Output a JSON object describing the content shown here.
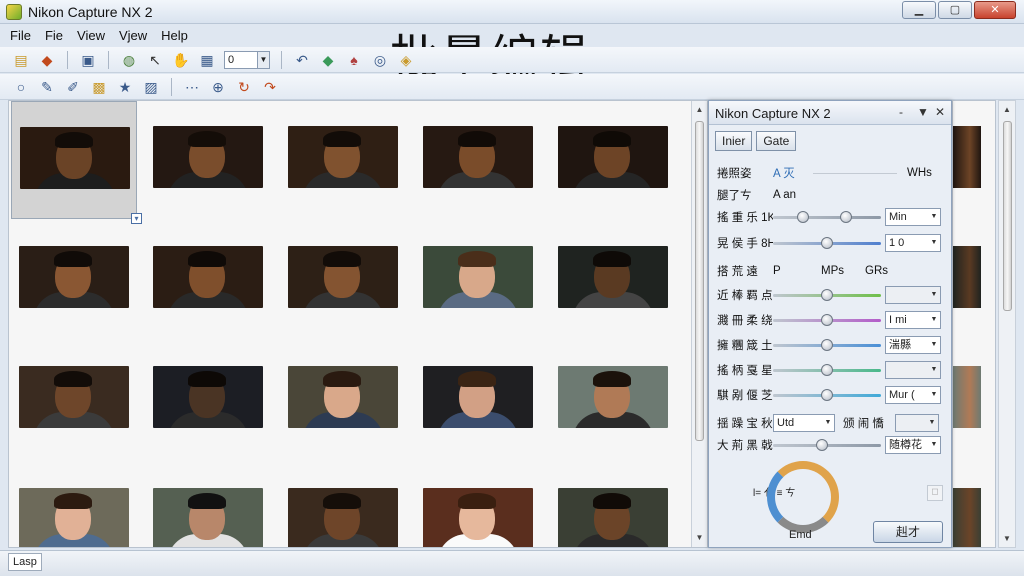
{
  "window": {
    "title": "Nikon Capture NX 2",
    "minimize": "▁",
    "maximize": "▢",
    "close": "✕"
  },
  "banner": "批量编辑",
  "menu": [
    "File",
    "Fie",
    "View",
    "Vjew",
    "Help"
  ],
  "toolbar": {
    "zoom_value": "0",
    "icons": [
      "new-file-icon",
      "open-icon",
      "save-icon",
      "zoom-icon",
      "pointer-icon",
      "hand-icon",
      "grid-icon"
    ]
  },
  "toolbar2_icons": [
    "search-icon",
    "lasso-icon",
    "brush-icon",
    "crop-icon",
    "star-icon",
    "edit-icon",
    "dots-icon",
    "zoom-in-icon",
    "rotate-icon",
    "undo-icon"
  ],
  "thumbnails": [
    {
      "skin": "#6a4326",
      "bg": "#2a1a10",
      "shirt": "#1d1d1d",
      "hair": "#120c08"
    },
    {
      "skin": "#7a4d2c",
      "bg": "#241812",
      "shirt": "#222",
      "hair": "#140d08"
    },
    {
      "skin": "#80522f",
      "bg": "#2f1f14",
      "shirt": "#2a2a2a",
      "hair": "#120c08"
    },
    {
      "skin": "#7a4c2a",
      "bg": "#261912",
      "shirt": "#333",
      "hair": "#110b07"
    },
    {
      "skin": "#6d4426",
      "bg": "#1f1510",
      "shirt": "#252525",
      "hair": "#0f0a06"
    },
    {
      "skin": "#8a5733",
      "bg": "#2a1e16",
      "shirt": "#2c2c2c",
      "hair": "#100b08"
    },
    {
      "skin": "#7f4f2c",
      "bg": "#2b1d14",
      "shirt": "#292929",
      "hair": "#0f0a07"
    },
    {
      "skin": "#845431",
      "bg": "#2d2016",
      "shirt": "#333",
      "hair": "#120c08"
    },
    {
      "skin": "#d8a88a",
      "bg": "#3b4a3a",
      "shirt": "#5a6b83",
      "hair": "#4a2e1a"
    },
    {
      "skin": "#5a3a22",
      "bg": "#1f2320",
      "shirt": "#444",
      "hair": "#0e0a07"
    },
    {
      "skin": "#6e462a",
      "bg": "#3a2b20",
      "shirt": "#3b3b3b",
      "hair": "#120c08"
    },
    {
      "skin": "#4a3424",
      "bg": "#1c1e24",
      "shirt": "#2b2b2b",
      "hair": "#0d0906"
    },
    {
      "skin": "#d9a88a",
      "bg": "#4a4638",
      "shirt": "#2d3b52",
      "hair": "#2a1a10"
    },
    {
      "skin": "#d2a085",
      "bg": "#1f1f22",
      "shirt": "#3b4d6d",
      "hair": "#3a2414"
    },
    {
      "skin": "#b07a56",
      "bg": "#6d7a72",
      "shirt": "#2b2b2b",
      "hair": "#1b120b"
    },
    {
      "skin": "#e1b196",
      "bg": "#6d6a5a",
      "shirt": "#4f6c8f",
      "hair": "#2c1b10"
    },
    {
      "skin": "#b8876a",
      "bg": "#556052",
      "shirt": "#e3e3e3",
      "hair": "#111"
    },
    {
      "skin": "#6e4529",
      "bg": "#3a2a1e",
      "shirt": "#3a3a3a",
      "hair": "#150e09"
    },
    {
      "skin": "#e6b89c",
      "bg": "#5a2e1e",
      "shirt": "#fafafa",
      "hair": "#3a1f10"
    },
    {
      "skin": "#6b4428",
      "bg": "#3a3f34",
      "shirt": "#2a2a2a",
      "hair": "#110b07"
    }
  ],
  "panel": {
    "title": "Nikon Capture NX 2",
    "controls": [
      "-",
      "▼",
      "✕"
    ],
    "tabs": [
      "Inier",
      "Gate"
    ],
    "row1": {
      "label": "捲照姿",
      "a": "A 灭",
      "b": "WHs"
    },
    "row2": {
      "label": "腿了ㄘ",
      "a": "A an"
    },
    "sliders": [
      {
        "label": "搖 重 乐 1K",
        "value": "Min",
        "knob": 0.25,
        "knob2": 0.7,
        "color": "#8d98a6"
      },
      {
        "label": "晃 侯 手 8H",
        "value": "1",
        "value2": "0",
        "knob": 0.5,
        "color": "#4f7fcf"
      }
    ],
    "row_mid": {
      "label": "搭 荒 遠",
      "a": "P",
      "b": "MPs",
      "c": "GRs"
    },
    "color_sliders": [
      {
        "label": "近 棒 羁 点",
        "value": "",
        "knob": 0.5,
        "color": "#6fbf4a"
      },
      {
        "label": "濺 冊 柔 绕",
        "value": "I mi",
        "knob": 0.5,
        "color": "#b35cc9"
      },
      {
        "label": "擁 糰 箴 土",
        "value": "湍縣",
        "knob": 0.5,
        "color": "#4a8fd6"
      },
      {
        "label": "搖 柄 戛 星",
        "value": "",
        "knob": 0.5,
        "color": "#49b88a"
      },
      {
        "label": "騏 剐 偃 芝",
        "value": "Mur (",
        "knob": 0.5,
        "color": "#40a9d8"
      }
    ],
    "row_select": {
      "label": "揺 躁 宝 秋",
      "value": "Utd",
      "label2": "颁 闹 憍"
    },
    "row_last": {
      "label": "大 荊 黑 戟",
      "value": "随樽花",
      "knob": 0.45,
      "color": "#8d98a6"
    },
    "wheel_label": "Emd",
    "scale_label": "l= 亻 ≡ ㄘ",
    "apply_label": "赳才",
    "colors": {
      "accent": "#4e8fd1",
      "warm": "#e0a34a"
    }
  },
  "status": {
    "text": "Lasp"
  }
}
